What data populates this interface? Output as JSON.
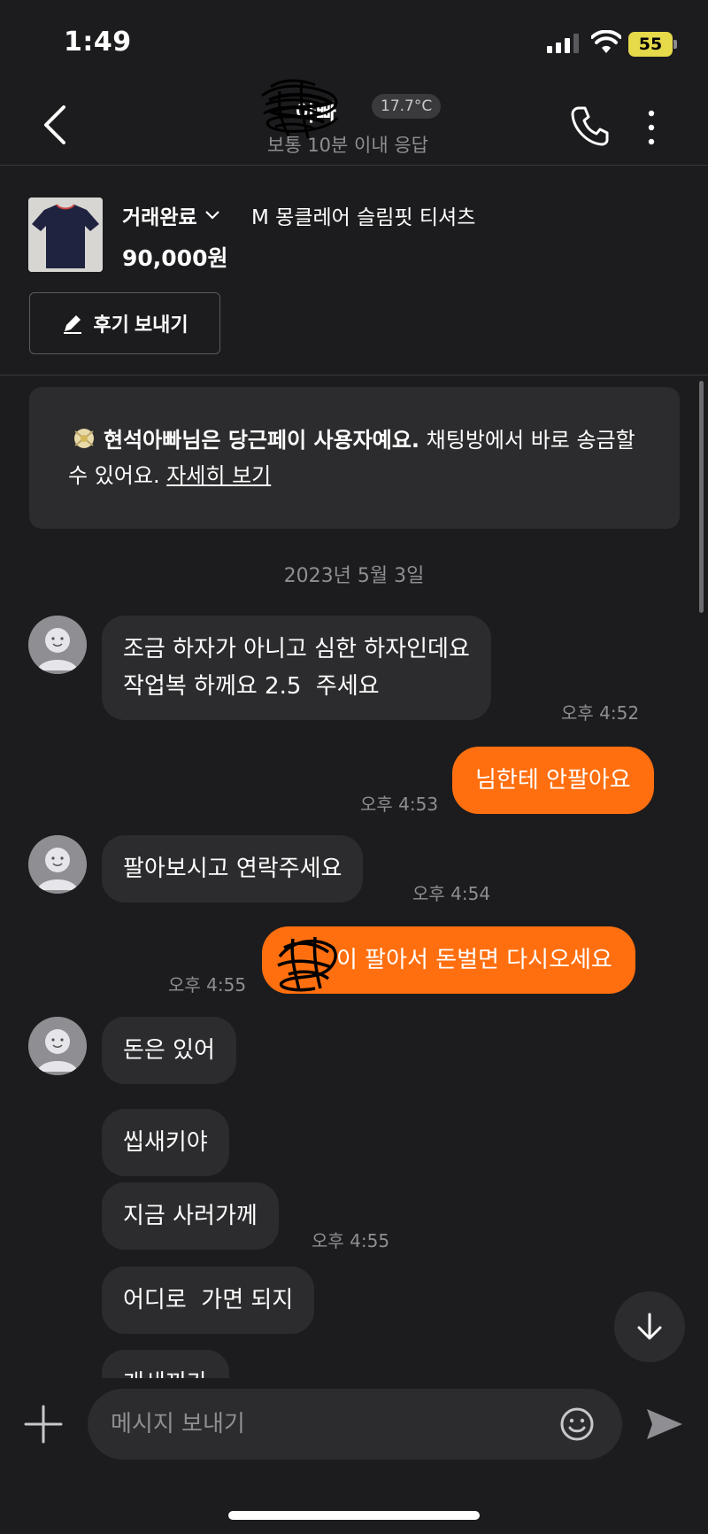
{
  "status_bar": {
    "time": "1:49",
    "battery": "55",
    "battery_color": "#e6d94a"
  },
  "header": {
    "user_name": "아빠",
    "temperature": "17.7°C",
    "response_time": "보통 10분 이내 응답",
    "icons": [
      "chevron-left-icon",
      "phone-icon",
      "more-vertical-icon"
    ]
  },
  "product": {
    "status": "거래완료",
    "title": "M 몽클레어 슬림핏 티셔츠",
    "price": "90,000원"
  },
  "review_button": "후기 보내기",
  "notice": {
    "bold_text": "현석아빠님은 당근페이 사용자예요.",
    "text": " 채팅방에서 바로 송금할 수 있어요. ",
    "link": "자세히 보기"
  },
  "date_label": "2023년 5월 3일",
  "messages": [
    {
      "side": "in",
      "text": "조금 하자가 아니고 심한 하자인데요\n작업복 하께요 2.5  주세요",
      "time": "오후 4:52"
    },
    {
      "side": "out",
      "text": "님한테 안팔아요",
      "time": "오후 4:53"
    },
    {
      "side": "in",
      "text": "팔아보시고 연락주세요",
      "time": "오후 4:54"
    },
    {
      "side": "out",
      "text": "이 팔아서 돈벌면 다시오세요",
      "time": "오후 4:55"
    },
    {
      "side": "in",
      "text": "돈은 있어"
    },
    {
      "side": "in",
      "text": "씹새키야"
    },
    {
      "side": "in",
      "text": "지금 사러가께",
      "time": "오후 4:55"
    },
    {
      "side": "in",
      "text": "어디로  가면 되지"
    },
    {
      "side": "in",
      "text": "개새끼가"
    }
  ],
  "input": {
    "placeholder": "메시지 보내기"
  },
  "colors": {
    "background": "#1c1c1e",
    "bubble_in": "#2c2c2e",
    "bubble_out": "#ff6f0f",
    "muted_text": "#8e8e93"
  }
}
